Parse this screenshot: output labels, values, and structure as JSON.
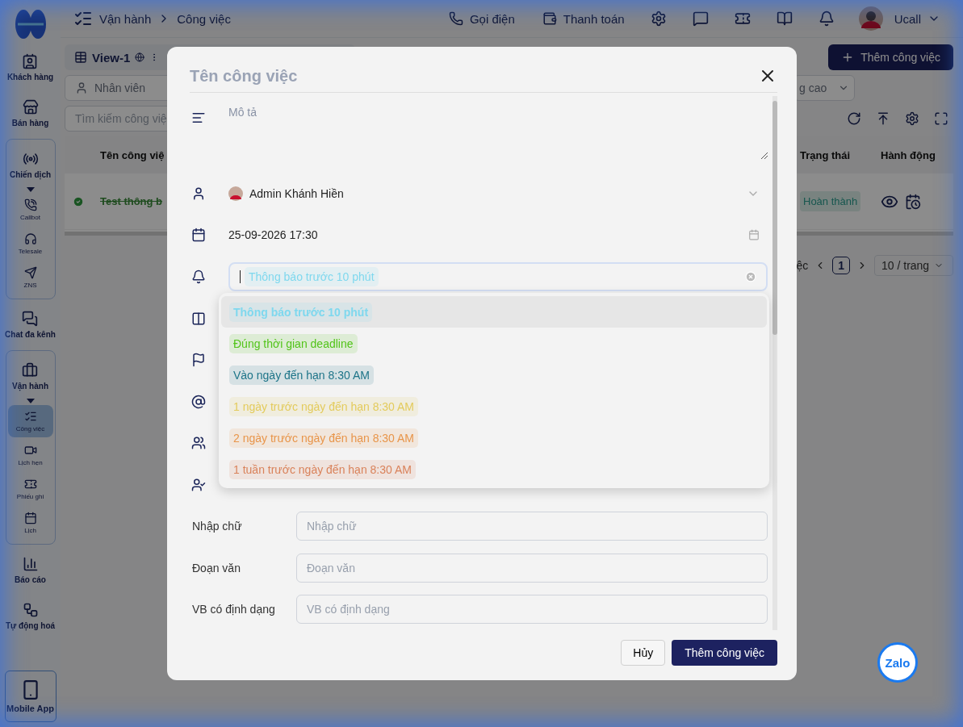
{
  "sidebar": {
    "items": [
      {
        "kind": "link",
        "label": "Khách hàng"
      },
      {
        "kind": "link",
        "label": "Bán hàng"
      },
      {
        "kind": "group",
        "label": "Chiến dịch",
        "children": [
          {
            "label": "Callbot",
            "selected": false
          },
          {
            "label": "Telesale",
            "selected": false
          },
          {
            "label": "ZNS",
            "selected": false
          }
        ]
      },
      {
        "kind": "link",
        "label": "Chat đa kênh"
      },
      {
        "kind": "group",
        "label": "Vận hành",
        "children": [
          {
            "label": "Công việc",
            "selected": true
          },
          {
            "label": "Lịch hẹn",
            "selected": false
          },
          {
            "label": "Phiếu ghi",
            "selected": false
          },
          {
            "label": "Lịch",
            "selected": false
          }
        ]
      },
      {
        "kind": "link",
        "label": "Báo cáo"
      },
      {
        "kind": "link",
        "label": "Tự động hoá"
      },
      {
        "kind": "app",
        "label": "Mobile App"
      }
    ]
  },
  "topbar": {
    "breadcrumb": [
      "Vận hành",
      "Công việc"
    ],
    "actions": [
      "Gọi điện",
      "Thanh toán"
    ],
    "user": "Ucall"
  },
  "toolbar": {
    "view": "View-1",
    "add_button": "Thêm công việc",
    "employee_filter": "Nhân viên",
    "advanced_filter": "g cao",
    "search_placeholder": "Tìm kiếm công việ"
  },
  "table": {
    "columns": [
      "Tên công việ",
      "Trạng thái",
      "Hành động"
    ],
    "rows": [
      {
        "name": "Test thông b",
        "done": true,
        "status": "Hoàn thành"
      }
    ]
  },
  "pagination": {
    "label": "ệc",
    "page": "1",
    "page_size": "10 / trang"
  },
  "modal": {
    "title_placeholder": "Tên công việc",
    "description_placeholder": "Mô tả",
    "assignee": "Admin Khánh Hiền",
    "deadline": "25-09-2026 17:30",
    "reminder": {
      "value": "Thông báo trước 10 phút",
      "color": "#7fd8ee"
    },
    "options": [
      {
        "label": "Thông báo trước 10 phút",
        "color": "#7fd8ee",
        "selected": true
      },
      {
        "label": "Đúng thời gian deadline",
        "color": "#52c41a",
        "selected": false
      },
      {
        "label": "Vào ngày đến hạn 8:30 AM",
        "color": "#1d7488",
        "selected": false
      },
      {
        "label": "1 ngày trước ngày đến hạn 8:30 AM",
        "color": "#e3cb5c",
        "selected": false
      },
      {
        "label": "2 ngày trước ngày đến hạn 8:30 AM",
        "color": "#e8954a",
        "selected": false
      },
      {
        "label": "1 tuần trước ngày đến hạn 8:30 AM",
        "color": "#d9825a",
        "selected": false
      }
    ],
    "custom_fields": [
      {
        "label": "Nhập chữ",
        "placeholder": "Nhập chữ"
      },
      {
        "label": "Đoạn văn",
        "placeholder": "Đoạn văn"
      },
      {
        "label": "VB có định dạng",
        "placeholder": "VB có định dạng"
      }
    ],
    "cancel": "Hủy",
    "submit": "Thêm công việc"
  },
  "zalo": "Zalo"
}
